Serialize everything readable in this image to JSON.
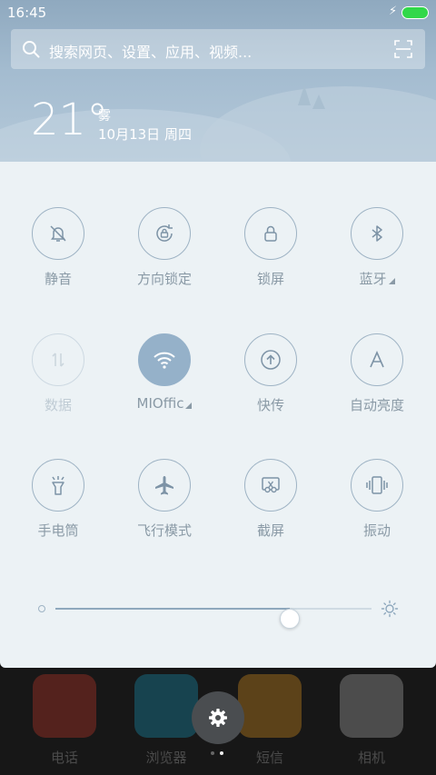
{
  "status_bar": {
    "time": "16:45"
  },
  "search": {
    "placeholder": "搜索网页、设置、应用、视频..."
  },
  "weather": {
    "temperature": "21°",
    "condition": "雾",
    "date": "10月13日 周四"
  },
  "toggles": [
    {
      "id": "silent",
      "label": "静音",
      "icon": "bell-off-icon",
      "state": "off"
    },
    {
      "id": "rotation-lock",
      "label": "方向锁定",
      "icon": "rotation-lock-icon",
      "state": "off"
    },
    {
      "id": "lock-screen",
      "label": "锁屏",
      "icon": "lock-icon",
      "state": "off"
    },
    {
      "id": "bluetooth",
      "label": "蓝牙",
      "icon": "bluetooth-icon",
      "state": "off",
      "has_more": true
    },
    {
      "id": "data",
      "label": "数据",
      "icon": "data-arrows-icon",
      "state": "disabled"
    },
    {
      "id": "wifi",
      "label": "MIOffic",
      "icon": "wifi-icon",
      "state": "on",
      "has_more": true
    },
    {
      "id": "quick-send",
      "label": "快传",
      "icon": "upload-icon",
      "state": "off"
    },
    {
      "id": "auto-brightness",
      "label": "自动亮度",
      "icon": "letter-a-icon",
      "state": "off"
    },
    {
      "id": "flashlight",
      "label": "手电筒",
      "icon": "flashlight-icon",
      "state": "off"
    },
    {
      "id": "airplane",
      "label": "飞行模式",
      "icon": "airplane-icon",
      "state": "off"
    },
    {
      "id": "screenshot",
      "label": "截屏",
      "icon": "scissors-icon",
      "state": "off"
    },
    {
      "id": "vibrate",
      "label": "振动",
      "icon": "vibrate-icon",
      "state": "off"
    }
  ],
  "brightness": {
    "level": 0.74
  },
  "dock": {
    "apps": [
      {
        "label": "电话",
        "color": "#d83a2a"
      },
      {
        "label": "浏览器",
        "color": "#1aa3c8"
      },
      {
        "label": "短信",
        "color": "#f0a020"
      },
      {
        "label": "相机",
        "color": "#bdbdbd"
      }
    ]
  },
  "colors": {
    "accent": "#95b1c9",
    "panel": "#ecf2f5",
    "battery": "#31d84a"
  }
}
